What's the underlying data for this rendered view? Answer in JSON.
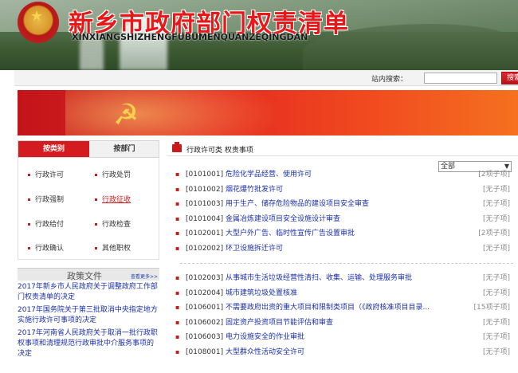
{
  "header": {
    "title_cn": "新乡市政府部门权责清单",
    "title_en": "XINXIANGSHIZHENGFUBUMENQUANZEQINGDAN"
  },
  "search": {
    "label": "站内搜索：",
    "placeholder": "",
    "button": "搜索"
  },
  "tabs": [
    {
      "label": "按类别",
      "active": true
    },
    {
      "label": "按部门",
      "active": false
    }
  ],
  "categories": [
    {
      "label": "行政许可"
    },
    {
      "label": "行政处罚"
    },
    {
      "label": "行政强制"
    },
    {
      "label": "行政征收",
      "highlight": true
    },
    {
      "label": "行政给付"
    },
    {
      "label": "行政检查"
    },
    {
      "label": "行政确认"
    },
    {
      "label": "其他职权"
    }
  ],
  "policy": {
    "title": "政策文件",
    "more": "查看更多>>",
    "items": [
      "2017年新乡市人民政府关于调整政府工作部门权责清单的决定",
      "2017年国务院关于第三批取消中央指定地方实施行政许可事项的决定",
      "2017年河南省人民政府关于取消一批行政职权事项和清理规范行政审批中介服务事项的决定"
    ]
  },
  "main": {
    "title": "行政许可类 权责事项",
    "filter": {
      "selected": "全部"
    },
    "group1": [
      {
        "code": "[0101001]",
        "name": "危险化学品经营、使用许可",
        "count": "[2项子项]"
      },
      {
        "code": "[0101002]",
        "name": "烟花爆竹批发许可",
        "count": "[无子项]"
      },
      {
        "code": "[0101003]",
        "name": "用于生产、储存危险物品的建设项目安全审查",
        "count": "[无子项]"
      },
      {
        "code": "[0101004]",
        "name": "金属冶炼建设项目安全设施设计审查",
        "count": "[无子项]"
      },
      {
        "code": "[0102001]",
        "name": "大型户外广告、临时性宣传广告设置审批",
        "count": "[2项子项]"
      },
      {
        "code": "[0102002]",
        "name": "环卫设施拆迁许可",
        "count": "[无子项]"
      }
    ],
    "group2": [
      {
        "code": "[0102003]",
        "name": "从事城市生活垃圾经营性清扫、收集、运输、处理服务审批",
        "count": "[无子项]"
      },
      {
        "code": "[0102004]",
        "name": "城市建筑垃圾处置核准",
        "count": "[无子项]"
      },
      {
        "code": "[0106001]",
        "name": "不需要政府出资的重大项目和限制类项目（《政府核准项目目录...",
        "count": "[15项子项]"
      },
      {
        "code": "[0106002]",
        "name": "固定资产投资项目节能评估和审查",
        "count": "[无子项]"
      },
      {
        "code": "[0106003]",
        "name": "电力设施安全的作业审批",
        "count": "[无子项]"
      },
      {
        "code": "[0108001]",
        "name": "大型群众性活动安全许可",
        "count": "[无子项]"
      }
    ]
  },
  "colors": {
    "accent": "#d41b1f",
    "link": "#1a2fa8"
  }
}
